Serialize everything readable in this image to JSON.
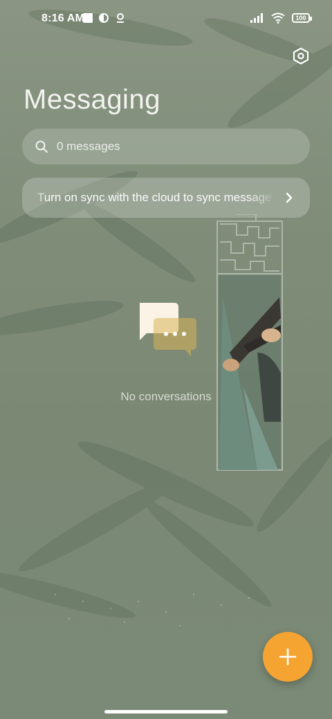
{
  "status_bar": {
    "time": "8:16 AM",
    "battery": "100"
  },
  "header": {
    "title": "Messaging",
    "settings_icon": "hexagon-settings-icon"
  },
  "search": {
    "placeholder": "0 messages"
  },
  "sync_banner": {
    "text": "Turn on sync with the cloud to sync messages"
  },
  "empty_state": {
    "text": "No conversations"
  },
  "fab": {
    "icon": "plus-icon",
    "color": "#f5a431"
  },
  "colors": {
    "background": "#7f8d79",
    "accent": "#f5a431"
  }
}
